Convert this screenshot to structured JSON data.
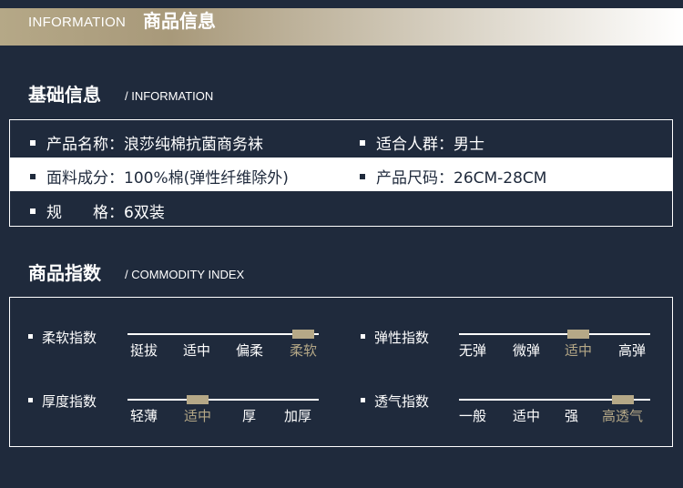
{
  "header": {
    "title_en": "INFORMATION",
    "title_cn": "商品信息"
  },
  "basic": {
    "title": "基础信息",
    "subtitle": "/ INFORMATION",
    "rows": [
      {
        "left": "产品名称：浪莎纯棉抗菌商务袜",
        "right": "适合人群：男士"
      },
      {
        "left": "面料成分：100%棉(弹性纤维除外)",
        "right": "产品尺码：26CM-28CM"
      },
      {
        "left": "规　　格：6双装"
      }
    ]
  },
  "commodity": {
    "title": "商品指数",
    "subtitle": "/ COMMODITY INDEX",
    "indices": [
      {
        "label": "柔软指数",
        "options": [
          "挺拔",
          "适中",
          "偏柔",
          "柔软"
        ],
        "selected": 3
      },
      {
        "label": "弹性指数",
        "options": [
          "无弹",
          "微弹",
          "适中",
          "高弹"
        ],
        "selected": 2
      },
      {
        "label": "厚度指数",
        "options": [
          "轻薄",
          "适中",
          "厚",
          "加厚"
        ],
        "selected": 1
      },
      {
        "label": "透气指数",
        "options": [
          "一般",
          "适中",
          "强",
          "高透气"
        ],
        "selected": 3
      }
    ]
  },
  "colors": {
    "background": "#1f2a3c",
    "accent": "#b5a887",
    "text": "#ffffff"
  }
}
